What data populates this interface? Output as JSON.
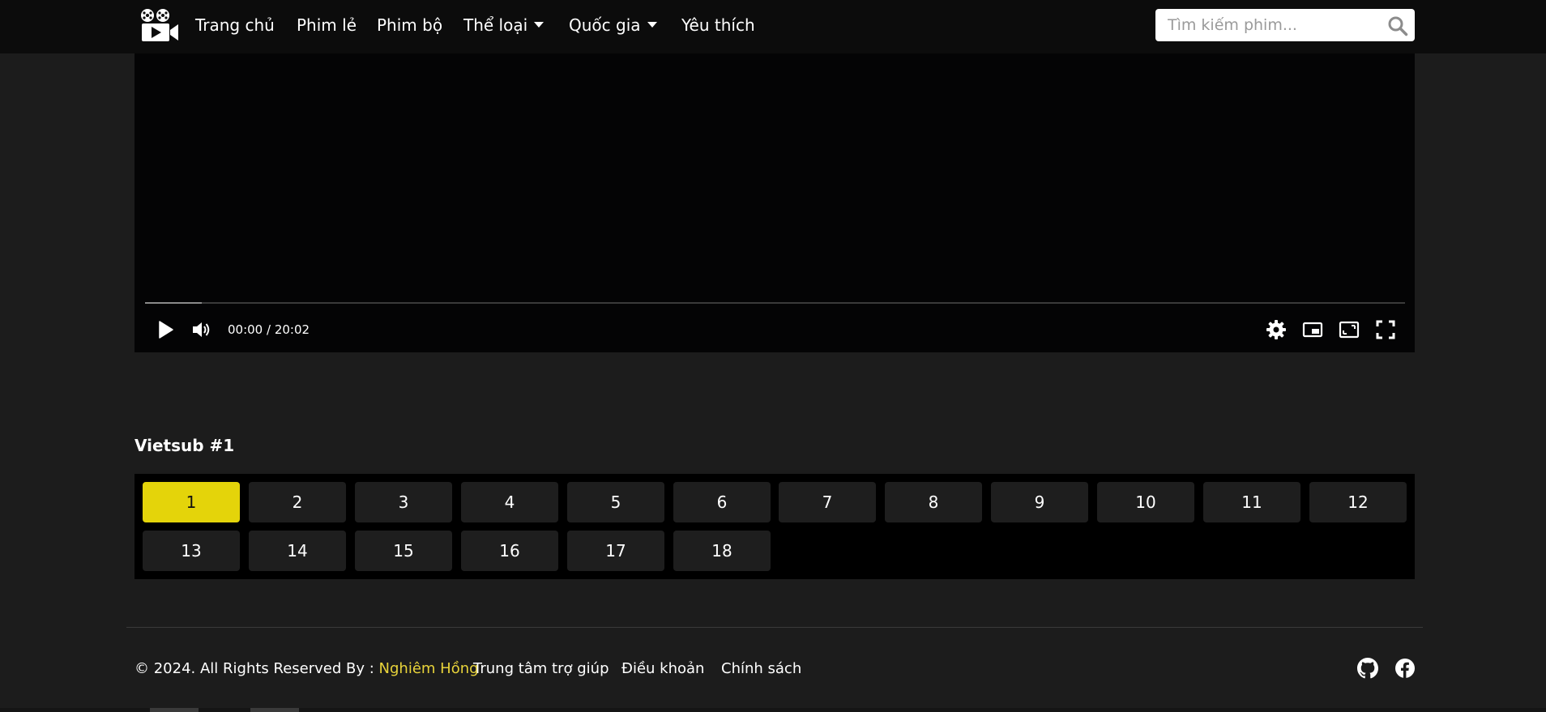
{
  "nav": {
    "logo_icon": "film-camera-icon",
    "items": [
      {
        "label": "Trang chủ"
      },
      {
        "label": "Phim lẻ"
      },
      {
        "label": "Phim bộ"
      },
      {
        "label": "Thể loại",
        "dropdown": true
      },
      {
        "label": "Quốc gia",
        "dropdown": true
      },
      {
        "label": "Yêu thích"
      }
    ],
    "search": {
      "placeholder": "Tìm kiếm phim...",
      "value": "",
      "icon": "search-icon"
    }
  },
  "player": {
    "current_time": "00:00",
    "duration": "20:02",
    "time_text": "00:00 / 20:02",
    "buffered_fraction": 0.045,
    "controls": [
      "play-icon",
      "volume-icon",
      "settings-icon",
      "miniplayer-icon",
      "theater-mode-icon",
      "fullscreen-icon"
    ]
  },
  "episodes": {
    "server_title": "Vietsub #1",
    "active": "1",
    "list": [
      "1",
      "2",
      "3",
      "4",
      "5",
      "6",
      "7",
      "8",
      "9",
      "10",
      "11",
      "12",
      "13",
      "14",
      "15",
      "16",
      "17",
      "18"
    ]
  },
  "footer": {
    "copyright": "© 2024. All Rights Reserved By : ",
    "author": "Nghiêm Hồng",
    "links": [
      "Trung tâm trợ giúp",
      "Điều khoản",
      "Chính sách"
    ],
    "social": [
      "github-icon",
      "facebook-icon"
    ]
  },
  "colors": {
    "background": "#1c1c1c",
    "navbar": "#0c0c0c",
    "accent": "#e4d40a",
    "author_link": "#e8d33a",
    "episode_button": "#1e1e1e"
  }
}
